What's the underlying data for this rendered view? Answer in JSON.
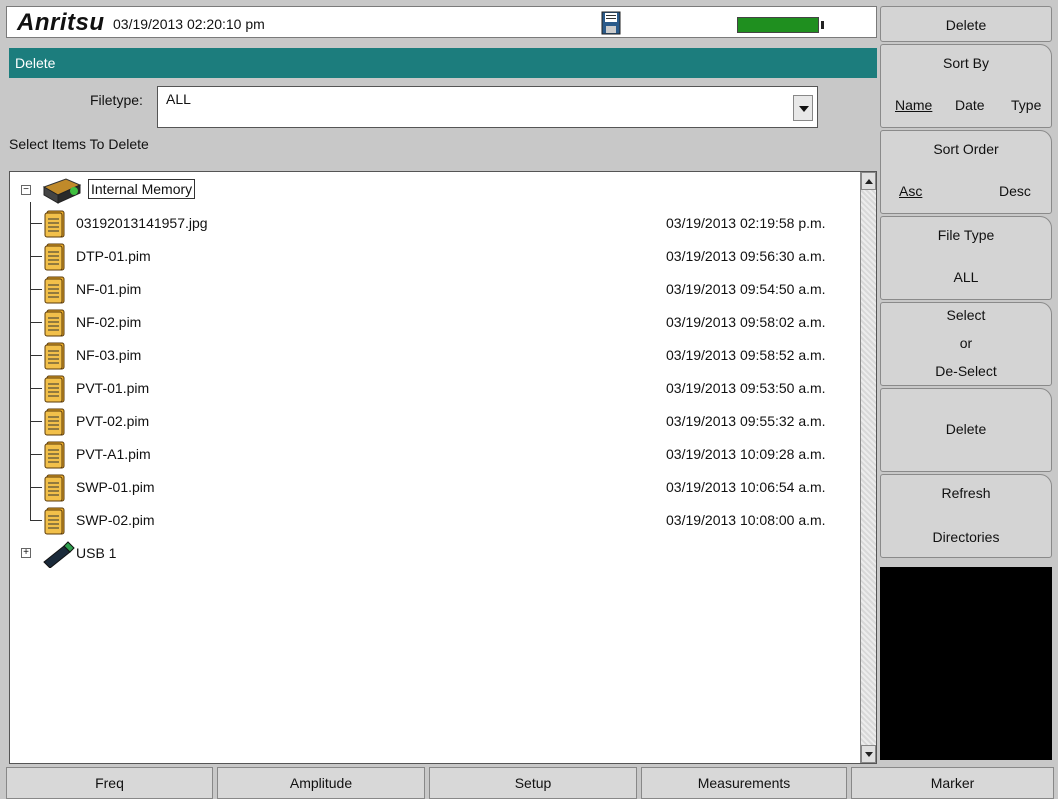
{
  "header": {
    "logo": "Anritsu",
    "datetime": "03/19/2013 02:20:10 pm",
    "battery_color": "#1f8f1f"
  },
  "title": "Delete",
  "filetype": {
    "label": "Filetype:",
    "value": "ALL"
  },
  "select_label": "Select Items To Delete",
  "tree": {
    "root": "Internal Memory",
    "files": [
      {
        "name": "03192013141957.jpg",
        "date": "03/19/2013 02:19:58 p.m."
      },
      {
        "name": "DTP-01.pim",
        "date": "03/19/2013 09:56:30 a.m."
      },
      {
        "name": "NF-01.pim",
        "date": "03/19/2013 09:54:50 a.m."
      },
      {
        "name": "NF-02.pim",
        "date": "03/19/2013 09:58:02 a.m."
      },
      {
        "name": "NF-03.pim",
        "date": "03/19/2013 09:58:52 a.m."
      },
      {
        "name": "PVT-01.pim",
        "date": "03/19/2013 09:53:50 a.m."
      },
      {
        "name": "PVT-02.pim",
        "date": "03/19/2013 09:55:32 a.m."
      },
      {
        "name": "PVT-A1.pim",
        "date": "03/19/2013 10:09:28 a.m."
      },
      {
        "name": "SWP-01.pim",
        "date": "03/19/2013 10:06:54 a.m."
      },
      {
        "name": "SWP-02.pim",
        "date": "03/19/2013 10:08:00 a.m."
      }
    ],
    "usb": "USB 1"
  },
  "softkeys": {
    "menu_title": "Delete",
    "sort_by": {
      "label": "Sort By",
      "name": "Name",
      "date": "Date",
      "type": "Type"
    },
    "sort_order": {
      "label": "Sort Order",
      "asc": "Asc",
      "desc": "Desc"
    },
    "file_type": {
      "label": "File Type",
      "value": "ALL"
    },
    "select": {
      "line1": "Select",
      "line2": "or",
      "line3": "De-Select"
    },
    "delete": "Delete",
    "refresh": {
      "line1": "Refresh",
      "line2": "Directories"
    }
  },
  "bottom_tabs": [
    "Freq",
    "Amplitude",
    "Setup",
    "Measurements",
    "Marker"
  ]
}
